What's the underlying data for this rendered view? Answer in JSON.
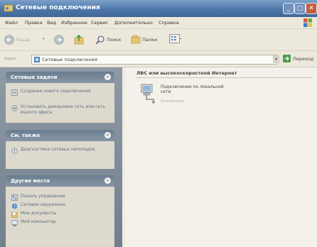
{
  "window": {
    "title": "Сетевые подключения",
    "controls": {
      "minimize": "_",
      "maximize": "□",
      "close": "✕"
    }
  },
  "menu": {
    "items": [
      "Файл",
      "Правка",
      "Вид",
      "Избранное",
      "Сервис",
      "Дополнительно",
      "Справка"
    ]
  },
  "toolbar": {
    "back_label": "Назад",
    "search_label": "Поиск",
    "folders_label": "Папки"
  },
  "address": {
    "label": "Адрес",
    "value": "Сетевые подключения",
    "go_label": "Переход"
  },
  "panels": {
    "tasks": {
      "title": "Сетевые задачи",
      "items": [
        {
          "label": "Создание нового подключения",
          "icon": "new-connection-icon"
        },
        {
          "label": "Установить домашнюю сеть или сеть малого офиса",
          "icon": "home-network-icon"
        }
      ]
    },
    "see_also": {
      "title": "См. также",
      "items": [
        {
          "label": "Диагностика сетевых неполадок",
          "icon": "diagnostics-icon"
        }
      ]
    },
    "other_places": {
      "title": "Другие места",
      "items": [
        {
          "label": "Панель управления",
          "icon": "control-panel-icon"
        },
        {
          "label": "Сетевое окружение",
          "icon": "network-places-icon"
        },
        {
          "label": "Мои документы",
          "icon": "my-documents-icon"
        },
        {
          "label": "Мой компьютер",
          "icon": "my-computer-icon"
        }
      ]
    }
  },
  "content": {
    "group_header": "ЛВС или высокоскоростной Интернет",
    "connections": [
      {
        "name": "Подключение по локальной сети",
        "status": "Отключено"
      }
    ]
  },
  "colors": {
    "titlebar": "#4d77a8",
    "taskpane": "#7f8b98",
    "panel_header": "#6a7c90",
    "link_text": "#5f6e80"
  }
}
